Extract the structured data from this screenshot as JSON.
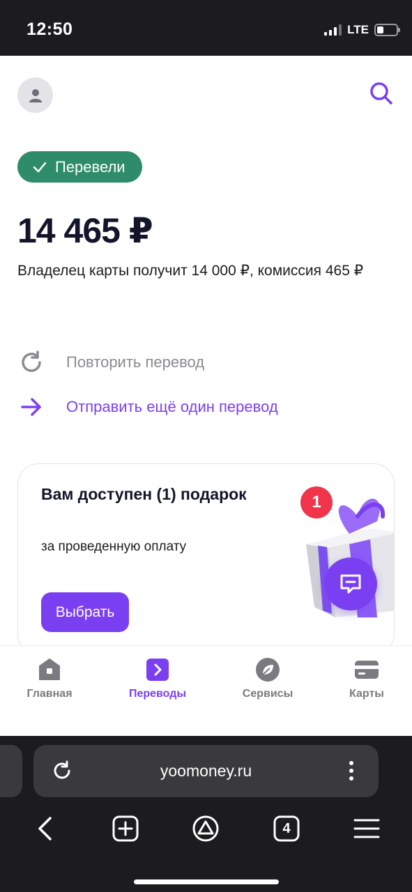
{
  "statusbar": {
    "time": "12:50",
    "network": "LTE",
    "battery_level": 0.35
  },
  "header": {
    "avatar_icon": "user-icon",
    "search_icon": "search-icon"
  },
  "payment": {
    "status": "Перевели",
    "amount": "14 465 ₽",
    "description": "Владелец карты получит 14 000 ₽, комиссия 465 ₽"
  },
  "actions": {
    "repeat": "Повторить перевод",
    "send_another": "Отправить ещё один перевод"
  },
  "gift": {
    "title": "Вам доступен (1) подарок",
    "subtitle": "за проведенную оплату",
    "badge": "1",
    "button": "Выбрать"
  },
  "tabs": [
    {
      "label": "Главная",
      "icon": "home-icon"
    },
    {
      "label": "Переводы",
      "icon": "transfers-icon",
      "active": true
    },
    {
      "label": "Сервисы",
      "icon": "services-icon"
    },
    {
      "label": "Карты",
      "icon": "card-icon"
    }
  ],
  "browser": {
    "url": "yoomoney.ru",
    "tab_count": "4"
  },
  "colors": {
    "accent": "#7b3ff2",
    "success": "#2e8c6a",
    "badge": "#f0344a",
    "text": "#14142b"
  }
}
